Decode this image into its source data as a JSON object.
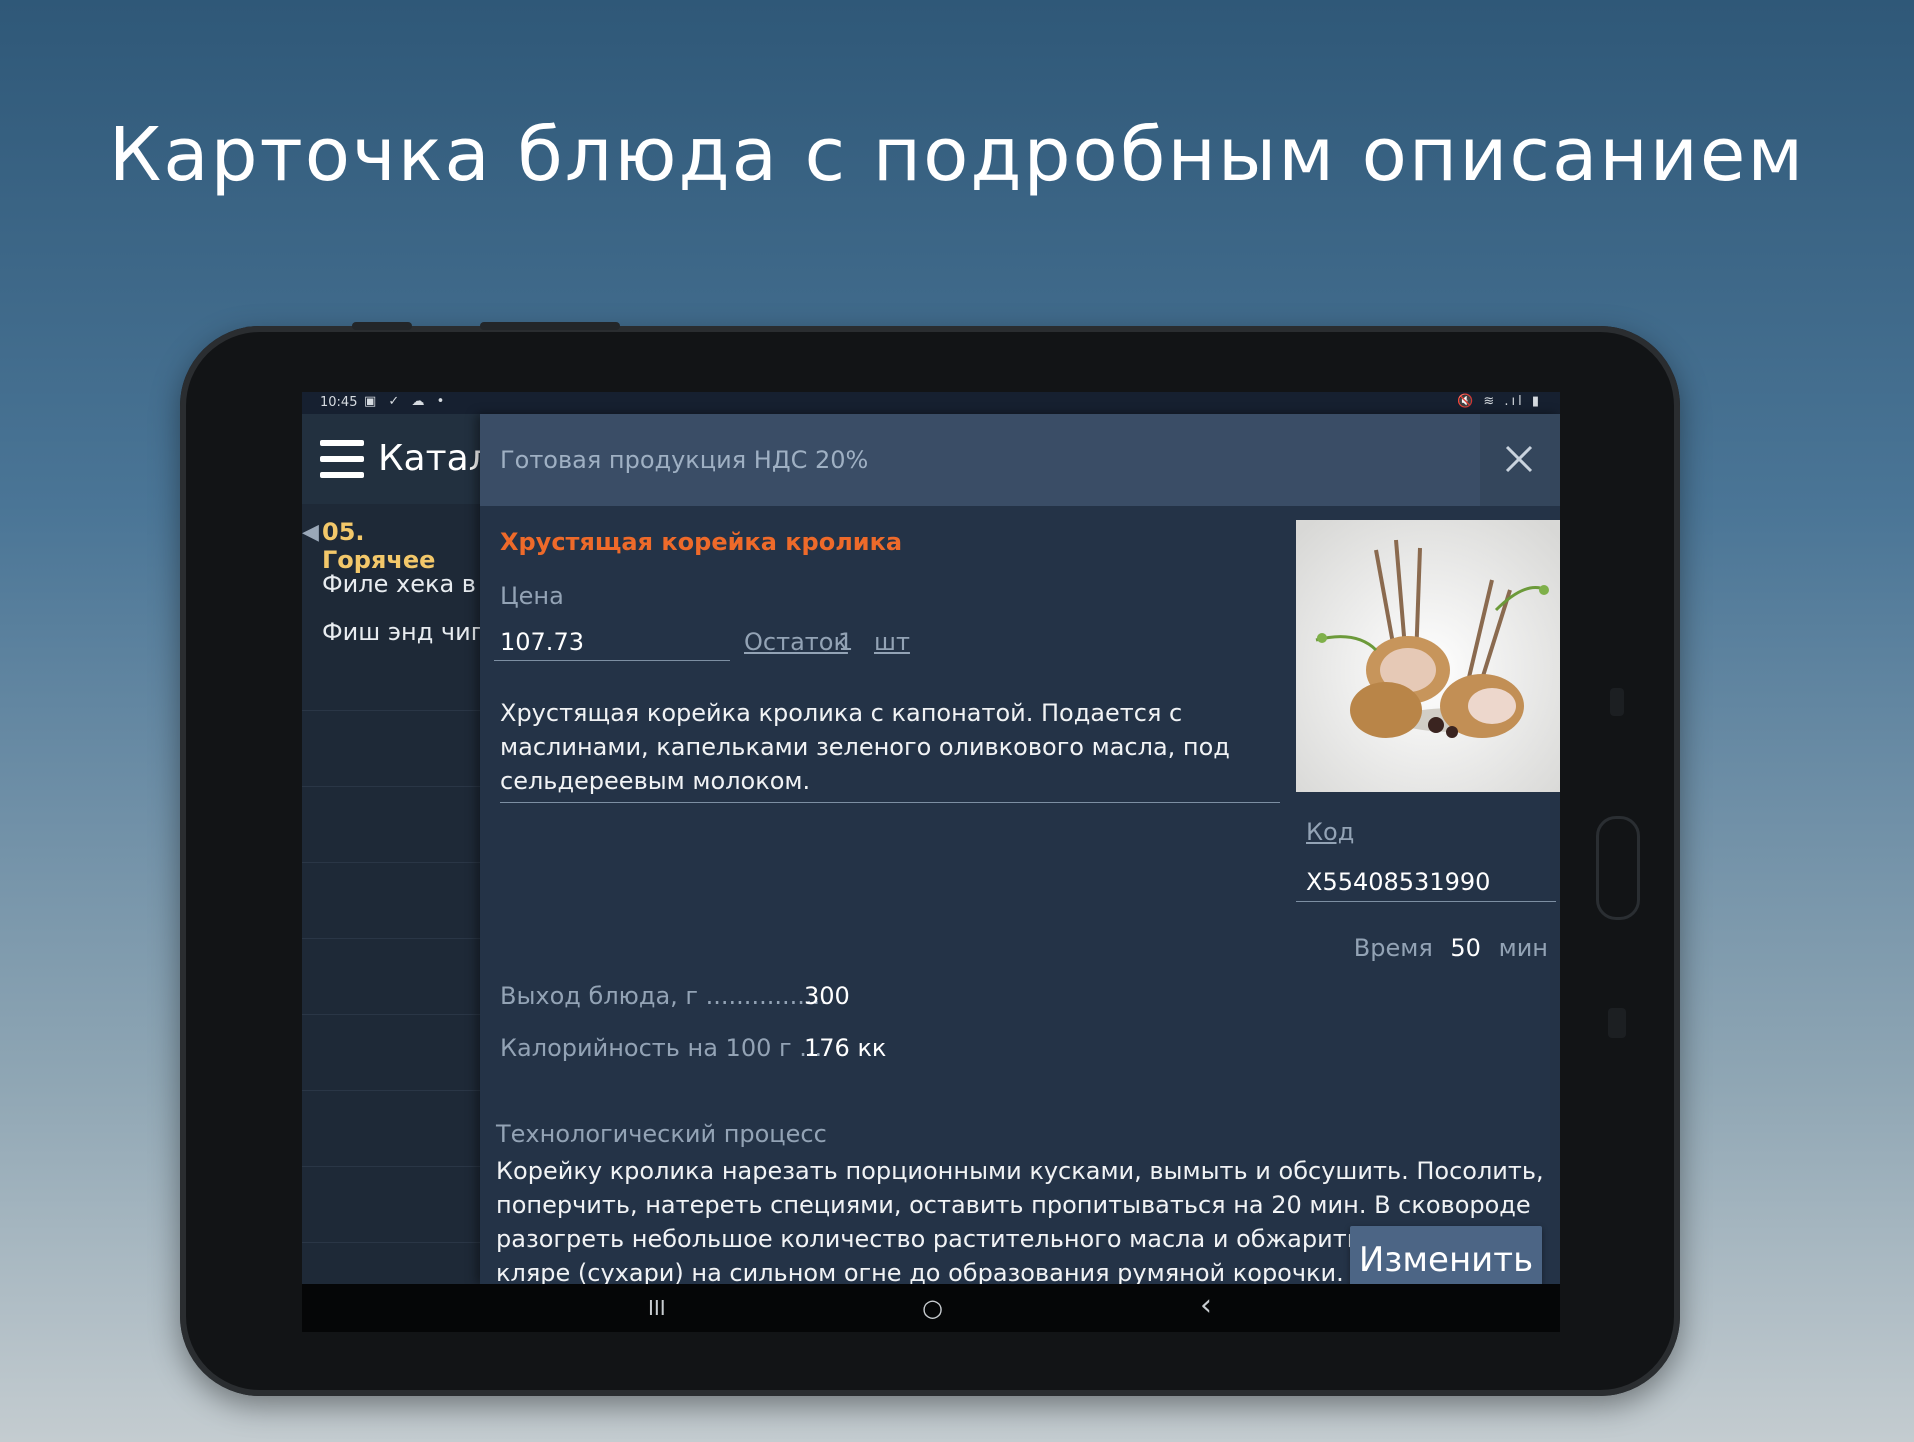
{
  "headline": "Карточка блюда с подробным описанием",
  "status_bar": {
    "time": "10:45",
    "left_icons": "▣ ✓ ☁ •",
    "right_icons": "🔇 ≋ .ıl ▮"
  },
  "app_bar": {
    "title": "Каталог"
  },
  "left_panel": {
    "group": "05. Горячее",
    "items": [
      "Филе хека в кляре",
      "Фиш энд чипс"
    ]
  },
  "dialog": {
    "header_title": "Готовая продукция НДС 20%",
    "product_name": "Хрустящая корейка кролика",
    "price_label": "Цена",
    "price_value": "107.73",
    "stock_label": "Остаток",
    "stock_value": "1",
    "stock_unit": "шт",
    "description": "Хрустящая корейка кролика с капонатой. Подается с маслинами, капельками зеленого оливкового масла, под сельдереевым молоком.",
    "code_label": "Код",
    "code_value": "X55408531990",
    "time_label": "Время",
    "time_value": "50",
    "time_unit": "мин",
    "yield_label": "Выход блюда, г ................",
    "yield_value": "300",
    "calorie_label": "Калорийность на 100 г ...",
    "calorie_value": "176 кк",
    "process_title": "Технологический процесс",
    "process_text": "Корейку кролика нарезать порционными кусками, вымыть и обсушить. Посолить, поперчить, натереть специями, оставить пропитываться на 20 мин. В сковороде разогреть небольшое количество растительного масла и обжарить кролика в кляре (сухари) на сильном огне до образования румяной корочки. Форму для запекания",
    "edit_button": "Изменить"
  },
  "nav_bar": {
    "recents": "III",
    "home": "○",
    "back": "‹"
  }
}
